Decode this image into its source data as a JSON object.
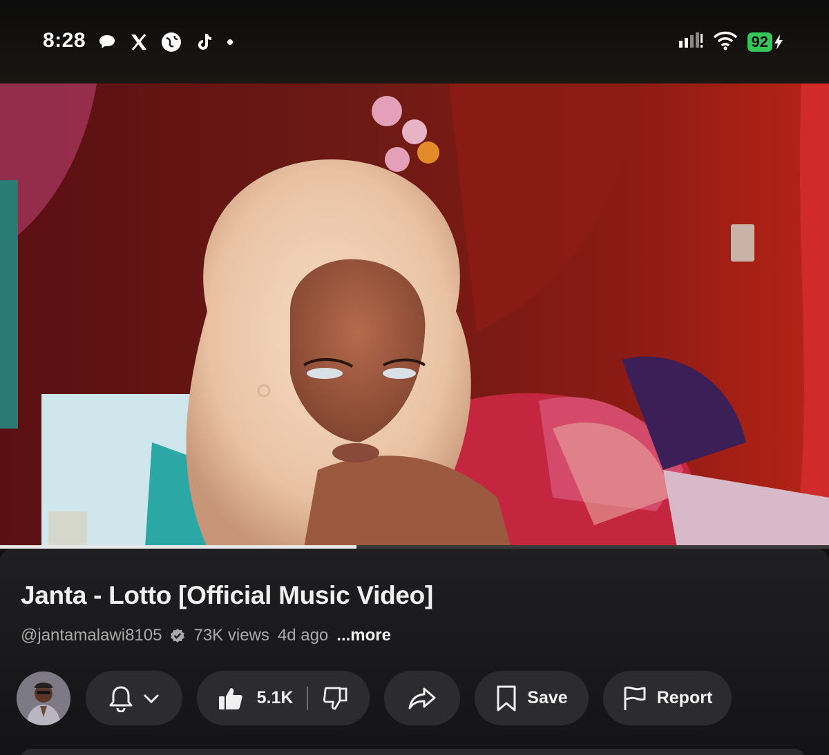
{
  "status_bar": {
    "time": "8:28",
    "battery_level": "92",
    "notification_icons": [
      "messages-icon",
      "x-icon",
      "browser-icon",
      "tiktok-icon",
      "dot-icon"
    ],
    "system_icons": [
      "signal-icon",
      "wifi-icon",
      "battery-icon",
      "charging-icon"
    ]
  },
  "player": {
    "progress_fraction": 0.43
  },
  "video": {
    "title": "Janta - Lotto [Official Music Video]",
    "channel_handle": "@jantamalawi8105",
    "views": "73K views",
    "age": "4d ago",
    "more_label": "...more"
  },
  "actions": {
    "like_count": "5.1K",
    "save_label": "Save",
    "report_label": "Report"
  },
  "colors": {
    "background": "#0f0f0f",
    "pill": "#2c2c2e",
    "battery": "#35c759"
  }
}
